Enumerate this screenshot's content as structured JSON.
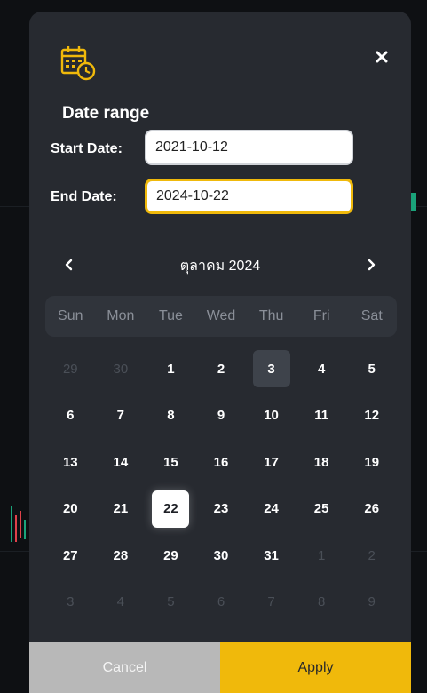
{
  "dialog": {
    "title": "Date range",
    "calendar_icon": "calendar-clock-icon",
    "close_icon": "close-icon"
  },
  "start_date": {
    "label": "Start Date:",
    "value": "2021-10-12"
  },
  "end_date": {
    "label": "End Date:",
    "value": "2024-10-22"
  },
  "calendar": {
    "month_label": "ตุลาคม 2024",
    "prev_icon": "chevron-left-icon",
    "next_icon": "chevron-right-icon",
    "weekdays": [
      "Sun",
      "Mon",
      "Tue",
      "Wed",
      "Thu",
      "Fri",
      "Sat"
    ],
    "days": [
      {
        "label": "29",
        "state": "muted"
      },
      {
        "label": "30",
        "state": "muted"
      },
      {
        "label": "1",
        "state": "normal"
      },
      {
        "label": "2",
        "state": "normal"
      },
      {
        "label": "3",
        "state": "today"
      },
      {
        "label": "4",
        "state": "normal"
      },
      {
        "label": "5",
        "state": "normal"
      },
      {
        "label": "6",
        "state": "normal"
      },
      {
        "label": "7",
        "state": "normal"
      },
      {
        "label": "8",
        "state": "normal"
      },
      {
        "label": "9",
        "state": "normal"
      },
      {
        "label": "10",
        "state": "normal"
      },
      {
        "label": "11",
        "state": "normal"
      },
      {
        "label": "12",
        "state": "normal"
      },
      {
        "label": "13",
        "state": "normal"
      },
      {
        "label": "14",
        "state": "normal"
      },
      {
        "label": "15",
        "state": "normal"
      },
      {
        "label": "16",
        "state": "normal"
      },
      {
        "label": "17",
        "state": "normal"
      },
      {
        "label": "18",
        "state": "normal"
      },
      {
        "label": "19",
        "state": "normal"
      },
      {
        "label": "20",
        "state": "normal"
      },
      {
        "label": "21",
        "state": "normal"
      },
      {
        "label": "22",
        "state": "selected"
      },
      {
        "label": "23",
        "state": "normal"
      },
      {
        "label": "24",
        "state": "normal"
      },
      {
        "label": "25",
        "state": "normal"
      },
      {
        "label": "26",
        "state": "normal"
      },
      {
        "label": "27",
        "state": "normal"
      },
      {
        "label": "28",
        "state": "normal"
      },
      {
        "label": "29",
        "state": "normal"
      },
      {
        "label": "30",
        "state": "normal"
      },
      {
        "label": "31",
        "state": "normal"
      },
      {
        "label": "1",
        "state": "muted"
      },
      {
        "label": "2",
        "state": "muted"
      },
      {
        "label": "3",
        "state": "muted"
      },
      {
        "label": "4",
        "state": "muted"
      },
      {
        "label": "5",
        "state": "muted"
      },
      {
        "label": "6",
        "state": "muted"
      },
      {
        "label": "7",
        "state": "muted"
      },
      {
        "label": "8",
        "state": "muted"
      },
      {
        "label": "9",
        "state": "muted"
      }
    ]
  },
  "footer": {
    "cancel_label": "Cancel",
    "apply_label": "Apply"
  },
  "colors": {
    "accent": "#f0b90b",
    "dialog_bg": "#272a30",
    "cancel_bg": "#b8b8b8"
  }
}
